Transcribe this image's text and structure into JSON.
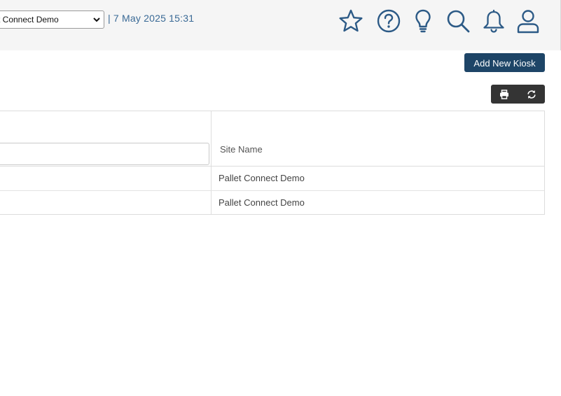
{
  "header": {
    "site_selected": "t Connect Demo",
    "datetime": "| 7 May 2025 15:31",
    "icons": [
      "star-icon",
      "help-icon",
      "lightbulb-icon",
      "search-icon",
      "bell-icon",
      "user-icon"
    ]
  },
  "toolbar": {
    "add_label": "Add New Kiosk"
  },
  "table": {
    "columns": [
      "",
      "Site Name"
    ],
    "rows": [
      {
        "col1": "",
        "site_name": "Pallet Connect Demo"
      },
      {
        "col1": "",
        "site_name": "Pallet Connect Demo"
      }
    ]
  },
  "colors": {
    "accent": "#1e4567",
    "icon_stroke": "#2c5a86",
    "topbar_bg": "#f5f5f5",
    "tool_bg": "#343434"
  }
}
